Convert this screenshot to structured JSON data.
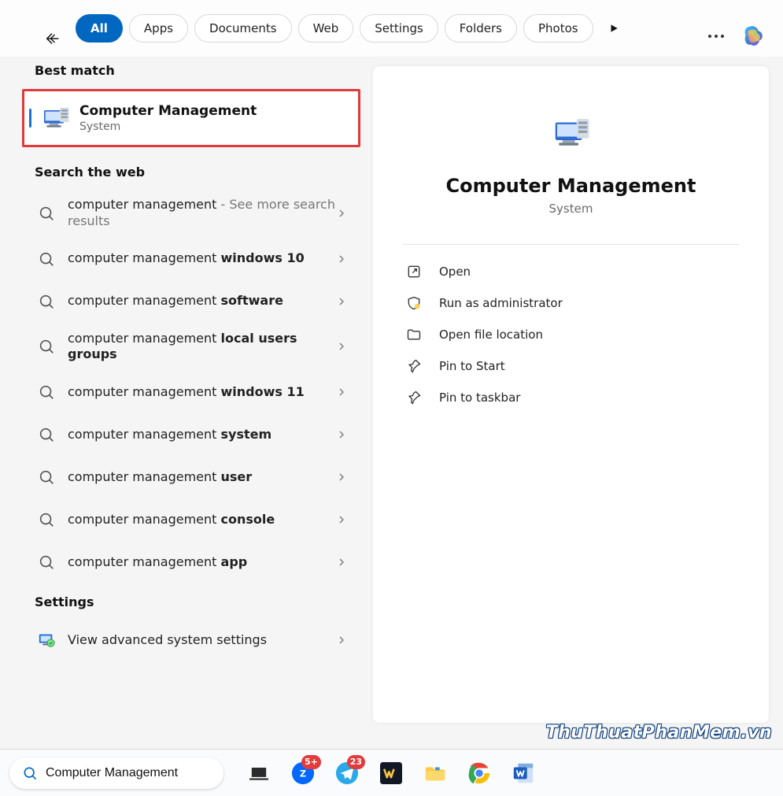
{
  "filters": {
    "all": "All",
    "apps": "Apps",
    "documents": "Documents",
    "web": "Web",
    "settings": "Settings",
    "folders": "Folders",
    "photos": "Photos"
  },
  "sections": {
    "best_match": "Best match",
    "search_web": "Search the web",
    "settings": "Settings"
  },
  "best_match": {
    "title": "Computer Management",
    "subtitle": "System"
  },
  "web_results": [
    {
      "prefix": "computer management",
      "suffix": "",
      "extra": " - See more search results"
    },
    {
      "prefix": "computer management ",
      "suffix": "windows 10",
      "extra": ""
    },
    {
      "prefix": "computer management ",
      "suffix": "software",
      "extra": ""
    },
    {
      "prefix": "computer management ",
      "suffix": "local users groups",
      "extra": ""
    },
    {
      "prefix": "computer management ",
      "suffix": "windows 11",
      "extra": ""
    },
    {
      "prefix": "computer management ",
      "suffix": "system",
      "extra": ""
    },
    {
      "prefix": "computer management ",
      "suffix": "user",
      "extra": ""
    },
    {
      "prefix": "computer management ",
      "suffix": "console",
      "extra": ""
    },
    {
      "prefix": "computer management ",
      "suffix": "app",
      "extra": ""
    }
  ],
  "settings_results": [
    {
      "label": "View advanced system settings"
    }
  ],
  "detail": {
    "title": "Computer Management",
    "subtitle": "System",
    "actions": {
      "open": "Open",
      "run_admin": "Run as administrator",
      "open_location": "Open file location",
      "pin_start": "Pin to Start",
      "pin_taskbar": "Pin to taskbar"
    }
  },
  "taskbar": {
    "search_value": "Computer Management",
    "badges": {
      "zalo": "5+",
      "telegram": "23"
    }
  },
  "watermark": "ThuThuatPhanMem.vn"
}
